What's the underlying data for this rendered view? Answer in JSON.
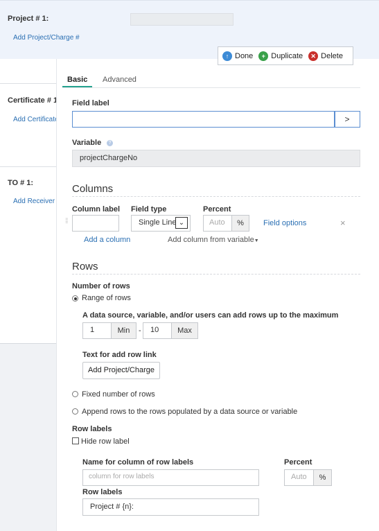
{
  "background": {
    "project": {
      "label": "Project # 1:",
      "link": "Add Project/Charge #"
    },
    "certificate": {
      "label": "Certificate # 1",
      "link": "Add Certificate"
    },
    "to": {
      "label": "TO # 1:",
      "link": "Add Receiver"
    }
  },
  "toolbar": {
    "done": "Done",
    "duplicate": "Duplicate",
    "delete": "Delete"
  },
  "tabs": {
    "basic": "Basic",
    "advanced": "Advanced"
  },
  "field_label": {
    "label": "Field label",
    "value": "",
    "go": ">"
  },
  "variable": {
    "label": "Variable",
    "value": "projectChargeNo"
  },
  "columns": {
    "heading": "Columns",
    "col_label_header": "Column label",
    "field_type_header": "Field type",
    "percent_header": "Percent",
    "field_type_value": "Single Line",
    "percent_placeholder": "Auto",
    "percent_unit": "%",
    "field_options": "Field options",
    "remove": "×",
    "add_column": "Add a column",
    "add_from_variable": "Add column from variable"
  },
  "rows": {
    "heading": "Rows",
    "number_label": "Number of rows",
    "range_option": "Range of rows",
    "range_desc": "A data source, variable, and/or users can add rows up to the maximum",
    "min_value": "1",
    "min_label": "Min",
    "dash": "-",
    "max_value": "10",
    "max_label": "Max",
    "add_link_label": "Text for add row link",
    "add_link_value": "Add Project/Charge",
    "fixed_option": "Fixed number of rows",
    "append_option": "Append rows to the rows populated by a data source or variable",
    "row_labels_heading": "Row labels",
    "hide_label": "Hide row label",
    "name_col_label": "Name for column of row labels",
    "name_col_placeholder": "column for row labels",
    "percent_label": "Percent",
    "percent_placeholder": "Auto",
    "percent_unit": "%",
    "row_labels_label": "Row labels",
    "row_labels_value": "Project # {n}:"
  },
  "colors": {
    "accent": "#25a28f",
    "link": "#2a6fb3",
    "done": "#3d8bd6",
    "duplicate": "#3aa14a",
    "delete": "#c9302c"
  }
}
